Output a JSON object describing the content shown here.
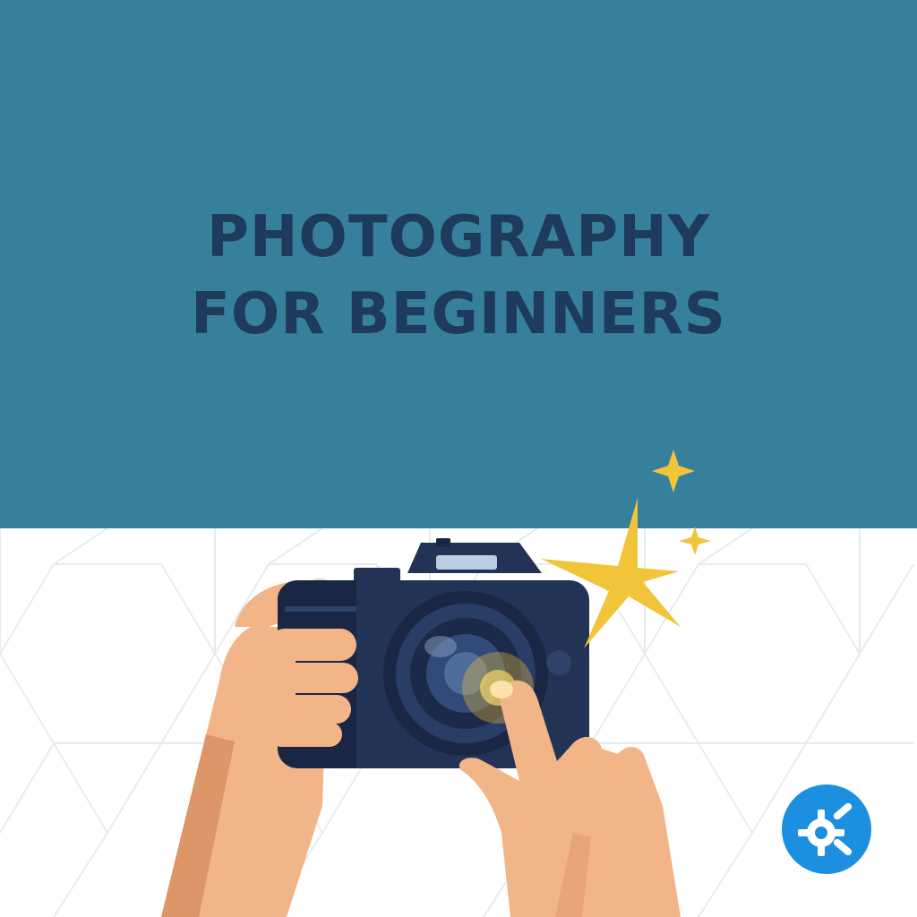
{
  "poster": {
    "title_line1": "PHOTOGRAPHY",
    "title_line2": "FOR BEGINNERS"
  },
  "colors": {
    "banner": "#36809c",
    "title": "#1e3a5c",
    "background": "#ffffff",
    "pattern_line": "#e6ebee",
    "camera_body": "#233356",
    "camera_shadow": "#1a2744",
    "skin": "#f2b588",
    "skin_shadow": "#dd9668",
    "sparkle": "#f2c43a",
    "badge": "#1d8fe0"
  },
  "icons": [
    "camera-icon",
    "sparkle-icon",
    "gear-badge-icon"
  ]
}
